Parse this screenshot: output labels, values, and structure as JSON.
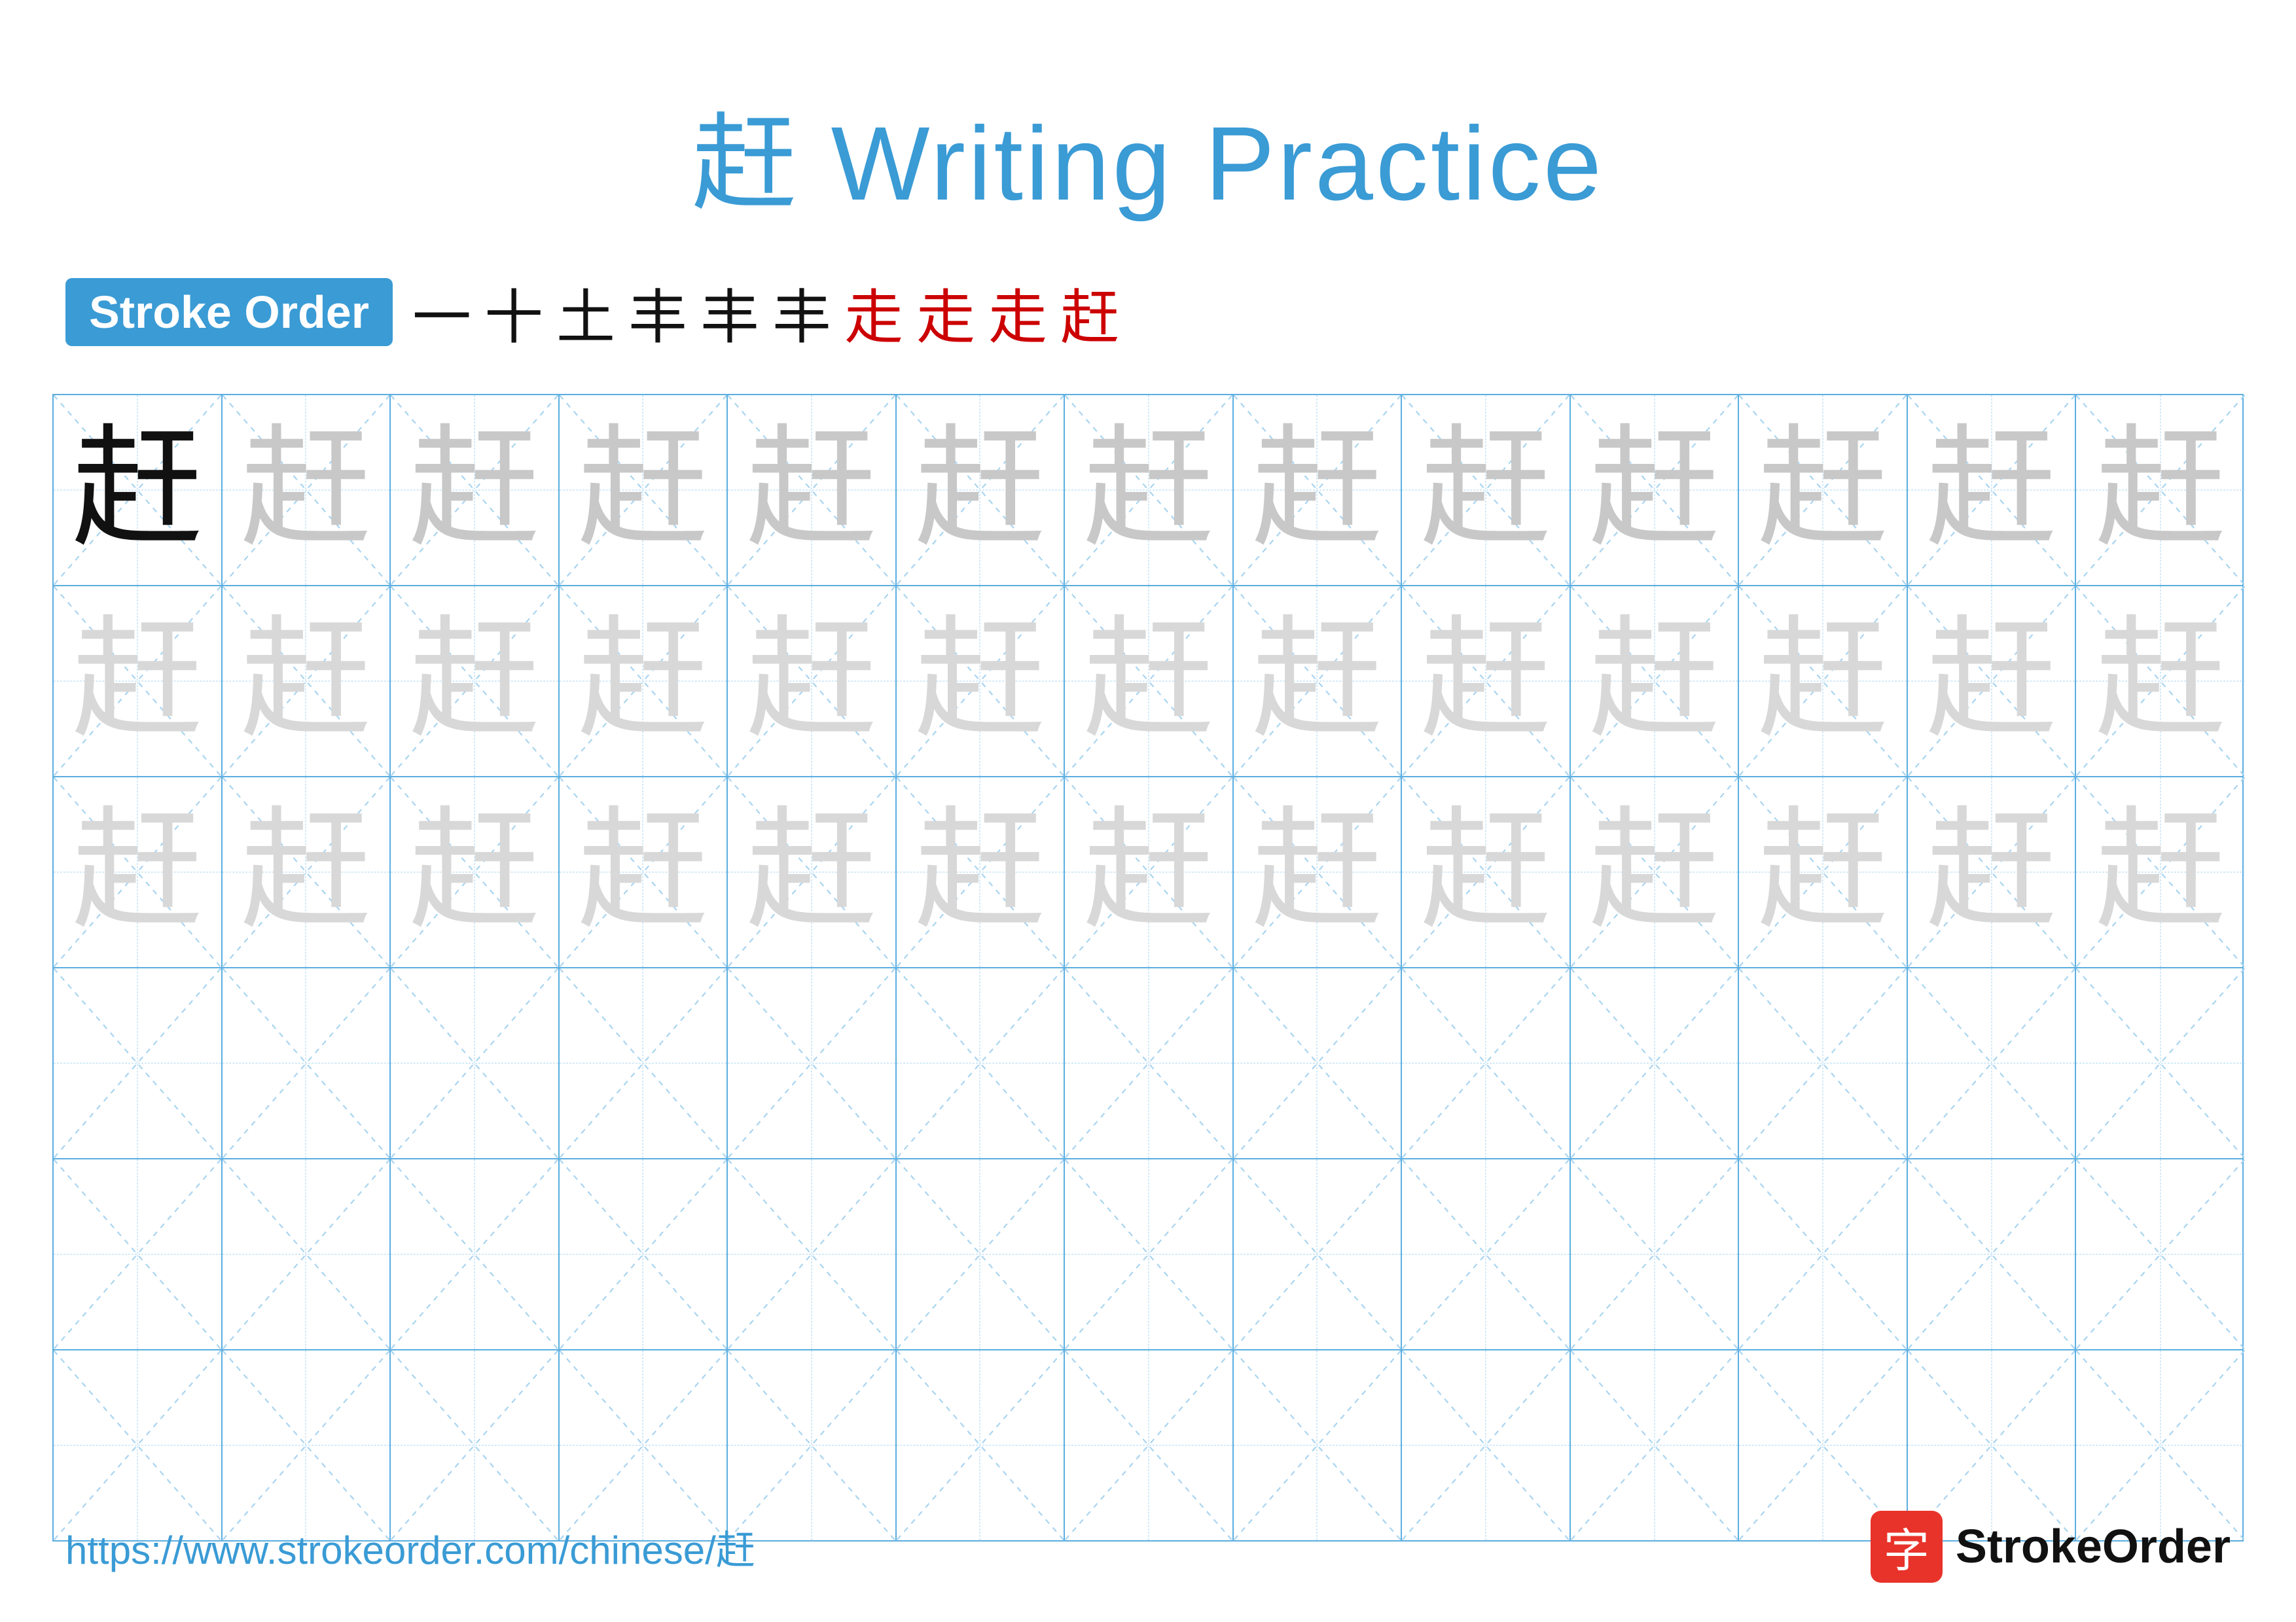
{
  "page": {
    "title": "赶 Writing Practice",
    "title_char": "赶",
    "title_suffix": " Writing Practice"
  },
  "stroke_order": {
    "badge_label": "Stroke Order",
    "strokes": [
      "一",
      "十",
      "土",
      "丰",
      "丰",
      "丰",
      "走",
      "走",
      "走",
      "赶"
    ]
  },
  "grid": {
    "rows": 6,
    "cols": 13,
    "char": "赶"
  },
  "footer": {
    "url": "https://www.strokeorder.com/chinese/赶",
    "logo_char": "字",
    "logo_label": "StrokeOrder"
  }
}
